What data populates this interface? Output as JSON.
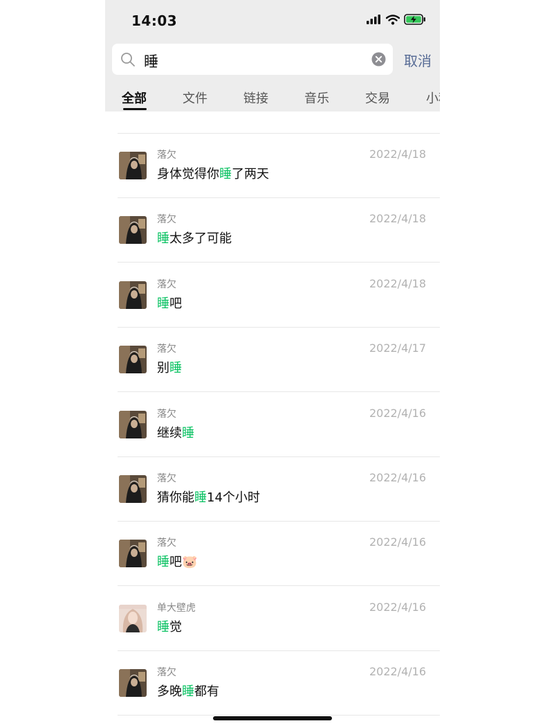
{
  "status_bar": {
    "time": "14:03"
  },
  "search": {
    "query": "睡",
    "cancel_label": "取消"
  },
  "tabs": [
    {
      "label": "全部",
      "active": true
    },
    {
      "label": "文件",
      "active": false
    },
    {
      "label": "链接",
      "active": false
    },
    {
      "label": "音乐",
      "active": false
    },
    {
      "label": "交易",
      "active": false
    },
    {
      "label": "小程序",
      "active": false
    }
  ],
  "results": [
    {
      "sender": "落欠",
      "date": "2022/4/18",
      "avatar": "dark",
      "parts": [
        {
          "t": "身体觉得你",
          "h": false
        },
        {
          "t": "睡",
          "h": true
        },
        {
          "t": "了两天",
          "h": false
        }
      ]
    },
    {
      "sender": "落欠",
      "date": "2022/4/18",
      "avatar": "dark",
      "parts": [
        {
          "t": "睡",
          "h": true
        },
        {
          "t": "太多了可能",
          "h": false
        }
      ]
    },
    {
      "sender": "落欠",
      "date": "2022/4/18",
      "avatar": "dark",
      "parts": [
        {
          "t": "睡",
          "h": true
        },
        {
          "t": "吧",
          "h": false
        }
      ]
    },
    {
      "sender": "落欠",
      "date": "2022/4/17",
      "avatar": "dark",
      "parts": [
        {
          "t": "别",
          "h": false
        },
        {
          "t": "睡",
          "h": true
        }
      ]
    },
    {
      "sender": "落欠",
      "date": "2022/4/16",
      "avatar": "dark",
      "parts": [
        {
          "t": "继续",
          "h": false
        },
        {
          "t": "睡",
          "h": true
        }
      ]
    },
    {
      "sender": "落欠",
      "date": "2022/4/16",
      "avatar": "dark",
      "parts": [
        {
          "t": "猜你能",
          "h": false
        },
        {
          "t": "睡",
          "h": true
        },
        {
          "t": "14个小时",
          "h": false
        }
      ]
    },
    {
      "sender": "落欠",
      "date": "2022/4/16",
      "avatar": "dark",
      "parts": [
        {
          "t": "睡",
          "h": true
        },
        {
          "t": "吧🐷",
          "h": false
        }
      ]
    },
    {
      "sender": "单大壁虎",
      "date": "2022/4/16",
      "avatar": "light",
      "parts": [
        {
          "t": "睡",
          "h": true
        },
        {
          "t": "觉",
          "h": false
        }
      ]
    },
    {
      "sender": "落欠",
      "date": "2022/4/16",
      "avatar": "dark",
      "parts": [
        {
          "t": "多晚",
          "h": false
        },
        {
          "t": "睡",
          "h": true
        },
        {
          "t": "都有",
          "h": false
        }
      ]
    }
  ],
  "colors": {
    "highlight": "#07c160",
    "cancel": "#576b95",
    "header_bg": "#ededed"
  },
  "icons": [
    "signal-icon",
    "wifi-icon",
    "battery-charging-icon",
    "search-icon",
    "clear-icon"
  ]
}
